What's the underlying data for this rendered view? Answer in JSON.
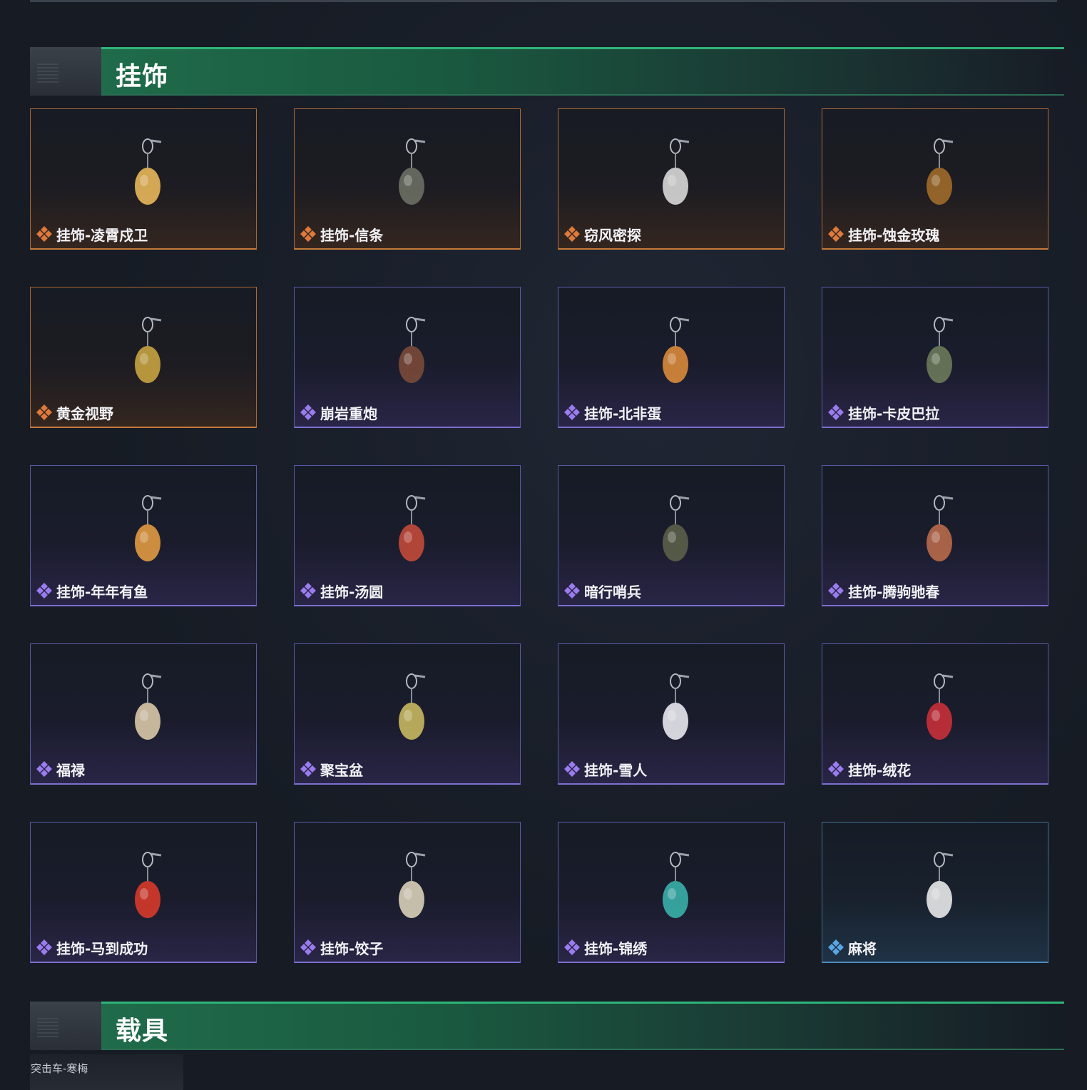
{
  "sections": [
    {
      "title": "挂饰"
    },
    {
      "title": "载具"
    }
  ],
  "colors": {
    "rarity_orange": "#e07a3a",
    "rarity_purple": "#9b7cf0",
    "rarity_blue": "#5aa7e6",
    "header_green": "#1f6b4a"
  },
  "items": [
    {
      "label": "挂饰-凌霄戍卫",
      "rarity": "orange",
      "icon": "cartoon-figure-charm-icon"
    },
    {
      "label": "挂饰-信条",
      "rarity": "orange",
      "icon": "dagger-charm-icon"
    },
    {
      "label": "窃风密探",
      "rarity": "orange",
      "icon": "mouse-figure-charm-icon"
    },
    {
      "label": "挂饰-蚀金玫瑰",
      "rarity": "orange",
      "icon": "rose-emblem-charm-icon"
    },
    {
      "label": "黄金视野",
      "rarity": "orange",
      "icon": "owl-figure-charm-icon"
    },
    {
      "label": "崩岩重炮",
      "rarity": "purple",
      "icon": "cannon-figure-charm-icon"
    },
    {
      "label": "挂饰-北非蛋",
      "rarity": "purple",
      "icon": "egg-pan-charm-icon"
    },
    {
      "label": "挂饰-卡皮巴拉",
      "rarity": "purple",
      "icon": "capybara-charm-icon"
    },
    {
      "label": "挂饰-年年有鱼",
      "rarity": "purple",
      "icon": "fish-charm-icon"
    },
    {
      "label": "挂饰-汤圆",
      "rarity": "purple",
      "icon": "dumpling-bowl-charm-icon"
    },
    {
      "label": "暗行哨兵",
      "rarity": "purple",
      "icon": "sentry-figure-charm-icon"
    },
    {
      "label": "挂饰-腾驹驰春",
      "rarity": "purple",
      "icon": "carriage-charm-icon"
    },
    {
      "label": "福禄",
      "rarity": "purple",
      "icon": "gourd-charm-icon"
    },
    {
      "label": "聚宝盆",
      "rarity": "purple",
      "icon": "treasure-bowl-charm-icon"
    },
    {
      "label": "挂饰-雪人",
      "rarity": "purple",
      "icon": "snowman-charm-icon"
    },
    {
      "label": "挂饰-绒花",
      "rarity": "purple",
      "icon": "flower-charm-icon"
    },
    {
      "label": "挂饰-马到成功",
      "rarity": "purple",
      "icon": "red-horse-charm-icon"
    },
    {
      "label": "挂饰-饺子",
      "rarity": "purple",
      "icon": "dumpling-plate-charm-icon"
    },
    {
      "label": "挂饰-锦绣",
      "rarity": "purple",
      "icon": "butterfly-charm-icon"
    },
    {
      "label": "麻将",
      "rarity": "blue",
      "icon": "mahjong-tile-charm-icon"
    }
  ],
  "vehicle_preview": {
    "label": "突击车-寒梅"
  }
}
